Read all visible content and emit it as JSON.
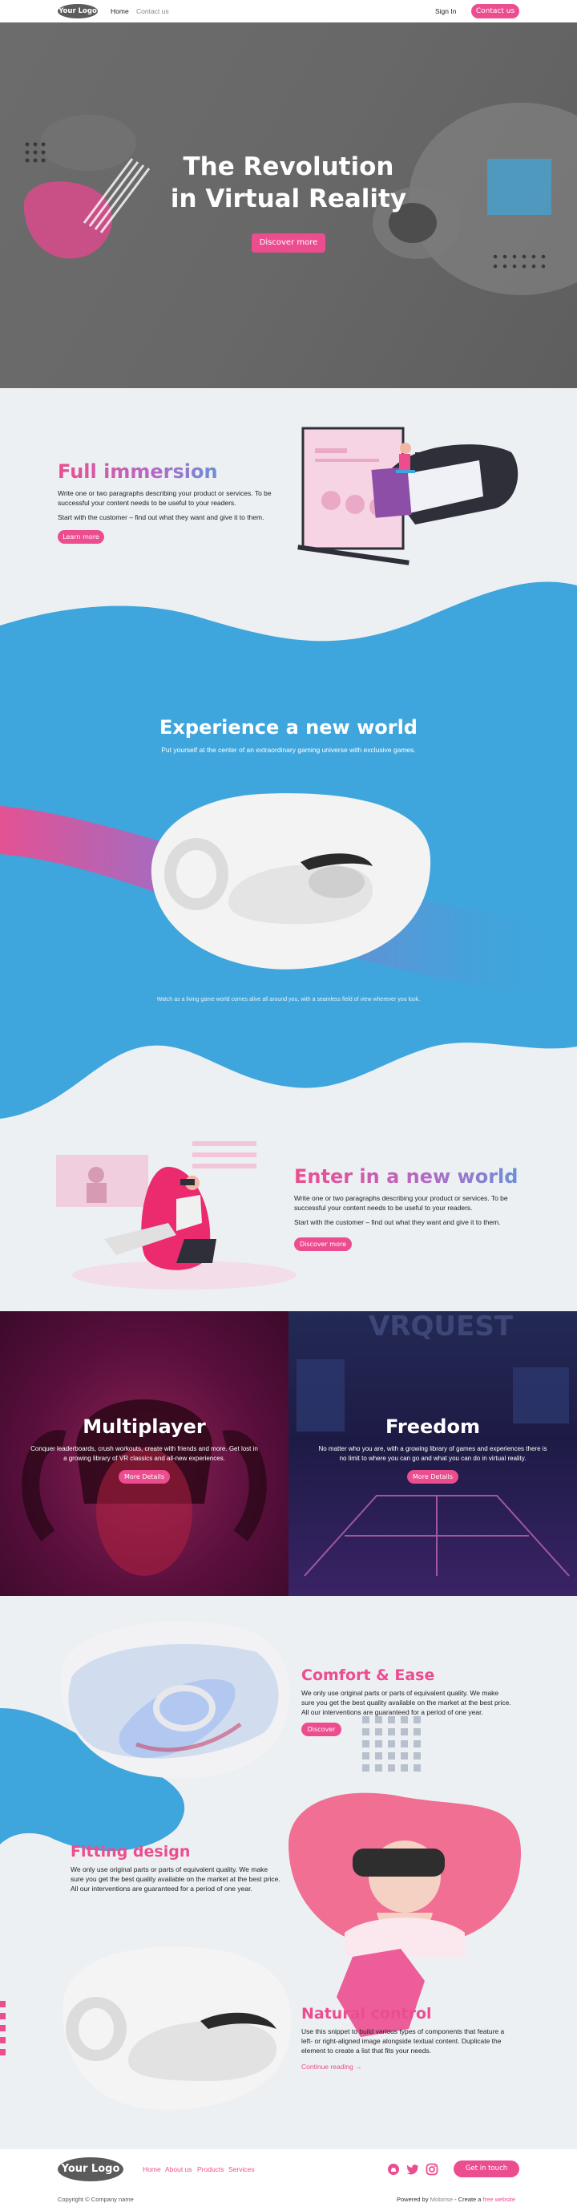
{
  "nav": {
    "logo": "Your Logo",
    "links": [
      "Home",
      "Contact us"
    ],
    "sign_in": "Sign In",
    "contact_button": "Contact us"
  },
  "hero": {
    "title_line1": "The Revolution",
    "title_line2": "in Virtual Reality",
    "button": "Discover more"
  },
  "immersion": {
    "title": "Full immersion",
    "p1": "Write one or two paragraphs describing your product or services. To be successful your content needs to be useful to your readers.",
    "p2": "Start with the customer – find out what they want and give it to them.",
    "button": "Learn more"
  },
  "experience": {
    "title": "Experience a new world",
    "subtitle": "Put yourself at the center of an extraordinary gaming universe with exclusive games.",
    "caption": "Watch as a living game world comes alive all around you, with a seamless field of view wherever you look."
  },
  "enter": {
    "title": "Enter in a new world",
    "p1": "Write one or two paragraphs describing your product or services. To be successful your content needs to be useful to your readers.",
    "p2": "Start with the customer – find out what they want and give it to them.",
    "button": "Discover more"
  },
  "cards": [
    {
      "title": "Multiplayer",
      "text": "Conquer leaderboards, crush workouts, create with friends and more. Get lost in a growing library of VR classics and all-new experiences.",
      "button": "More Details"
    },
    {
      "title": "Freedom",
      "text": "No matter who you are, with a growing library of games and experiences there is no limit to where you can go and what you can do in virtual reality.",
      "button": "More Details"
    }
  ],
  "features": [
    {
      "title": "Comfort & Ease",
      "text": "We only use original parts or parts of equivalent quality. We make sure you get the best quality available on the market at the best price. All our interventions are guaranteed for a period of one year.",
      "button": "Discover"
    },
    {
      "title": "Fitting design",
      "text": "We only use original parts or parts of equivalent quality. We make sure you get the best quality available on the market at the best price. All our interventions are guaranteed for a period of one year."
    },
    {
      "title": "Natural control",
      "text": "Use this snippet to build various types of components that feature a left- or right-aligned image alongside textual content. Duplicate the element to create a list that fits your needs.",
      "link": "Continue reading →"
    }
  ],
  "footer": {
    "logo": "Your Logo",
    "links": [
      "Home",
      "About us",
      "Products",
      "Services"
    ],
    "button": "Get in touch",
    "copyright": "Copyright © Company name",
    "powered_prefix": "Powered by",
    "powered_brand": "Mobirise",
    "create_prefix": " - Create a",
    "create_link": "free website"
  },
  "icons": [
    "github-icon",
    "twitter-icon",
    "instagram-icon"
  ],
  "colors": {
    "accent": "#ec4d8f",
    "blue": "#3ea6dc",
    "bg": "#ecf0f3",
    "dark_purple": "#5a0f3d",
    "dark_navy": "#1d1b45"
  }
}
